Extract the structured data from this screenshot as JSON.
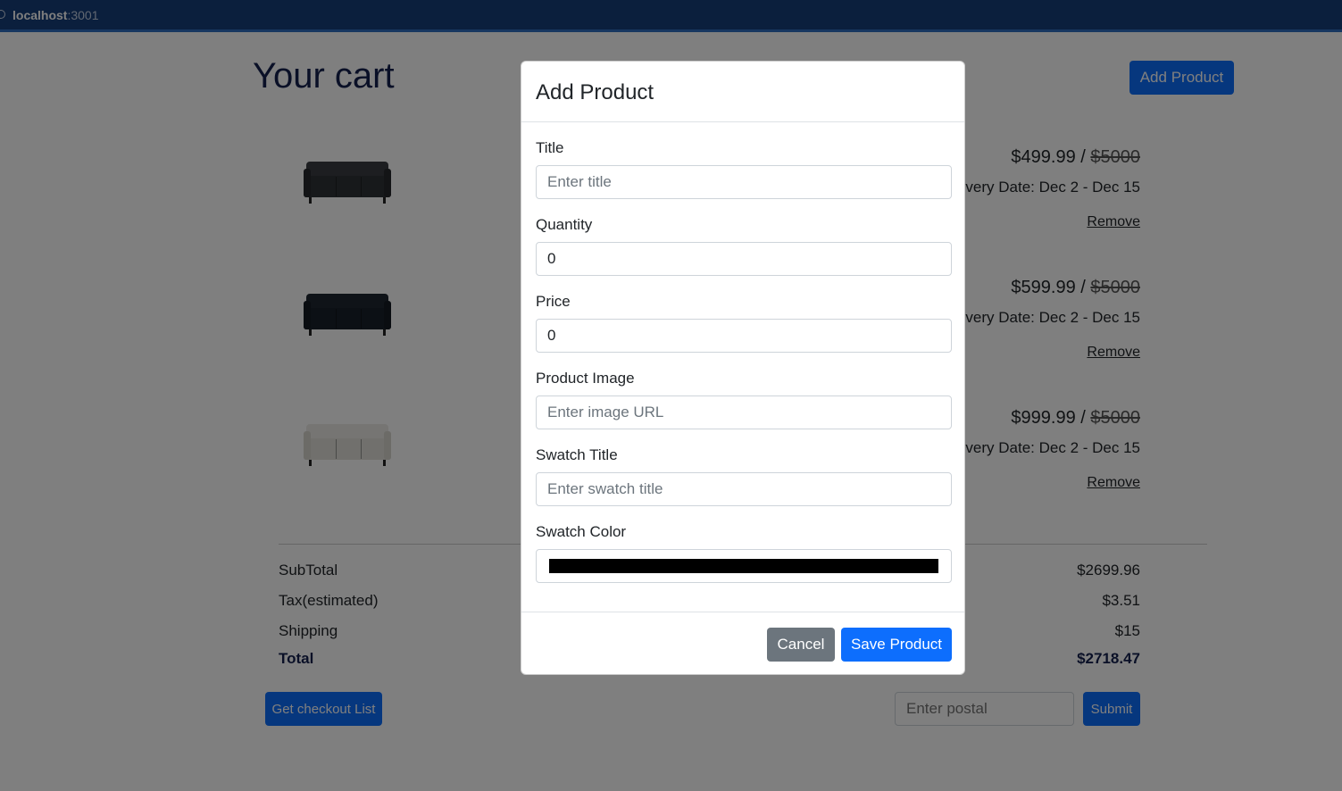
{
  "browser": {
    "host": "localhost",
    "port": ":3001"
  },
  "page": {
    "title": "Your cart",
    "add_product_label": "Add Product",
    "items": [
      {
        "price": "$499.99",
        "separator": " / ",
        "old_price": "$5000",
        "delivery": "elivery Date: Dec 2 - Dec 15",
        "remove": "Remove",
        "sofa_color": "#3a3d42"
      },
      {
        "price": "$599.99",
        "separator": " / ",
        "old_price": "$5000",
        "delivery": "elivery Date: Dec 2 - Dec 15",
        "remove": "Remove",
        "sofa_color": "#1f2630"
      },
      {
        "price": "$999.99",
        "separator": " / ",
        "old_price": "$5000",
        "delivery": "elivery Date: Dec 2 - Dec 15",
        "remove": "Remove",
        "sofa_color": "#e9e7e2"
      }
    ],
    "summary": {
      "subtotal_label": "SubTotal",
      "subtotal_value": "$2699.96",
      "tax_label": "Tax(estimated)",
      "tax_value": "$3.51",
      "shipping_label": "Shipping",
      "shipping_value": "$15",
      "total_label": "Total",
      "total_value": "$2718.47"
    },
    "checkout_label": "Get checkout List",
    "postal_placeholder": "Enter postal",
    "submit_label": "Submit"
  },
  "modal": {
    "title": "Add Product",
    "fields": {
      "title_label": "Title",
      "title_placeholder": "Enter title",
      "quantity_label": "Quantity",
      "quantity_value": "0",
      "price_label": "Price",
      "price_value": "0",
      "image_label": "Product Image",
      "image_placeholder": "Enter image URL",
      "swatch_title_label": "Swatch Title",
      "swatch_title_placeholder": "Enter swatch title",
      "swatch_color_label": "Swatch Color",
      "swatch_color_value": "#000000"
    },
    "cancel_label": "Cancel",
    "save_label": "Save Product"
  }
}
